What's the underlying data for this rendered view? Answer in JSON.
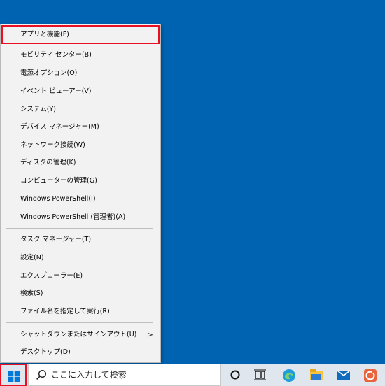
{
  "context_menu": {
    "items": [
      {
        "label": "アプリと機能(F)"
      },
      {
        "label": "モビリティ センター(B)"
      },
      {
        "label": "電源オプション(O)"
      },
      {
        "label": "イベント ビューアー(V)"
      },
      {
        "label": "システム(Y)"
      },
      {
        "label": "デバイス マネージャー(M)"
      },
      {
        "label": "ネットワーク接続(W)"
      },
      {
        "label": "ディスクの管理(K)"
      },
      {
        "label": "コンピューターの管理(G)"
      },
      {
        "label": "Windows PowerShell(I)"
      },
      {
        "label": "Windows PowerShell (管理者)(A)"
      },
      {
        "label": "タスク マネージャー(T)"
      },
      {
        "label": "設定(N)"
      },
      {
        "label": "エクスプローラー(E)"
      },
      {
        "label": "検索(S)"
      },
      {
        "label": "ファイル名を指定して実行(R)"
      },
      {
        "label": "シャットダウンまたはサインアウト(U)"
      },
      {
        "label": "デスクトップ(D)"
      }
    ],
    "submenu_arrow": ">"
  },
  "taskbar": {
    "search_placeholder": "ここに入力して検索",
    "icons": [
      "windows-start-icon",
      "search-icon",
      "cortana-icon",
      "task-view-icon",
      "edge-icon",
      "file-explorer-icon",
      "mail-icon",
      "office-icon"
    ]
  },
  "colors": {
    "desktop": "#0063b1",
    "highlight_outline": "#e81123",
    "menu_bg": "#f2f2f2",
    "taskbar_bg": "#dfe6ee"
  }
}
